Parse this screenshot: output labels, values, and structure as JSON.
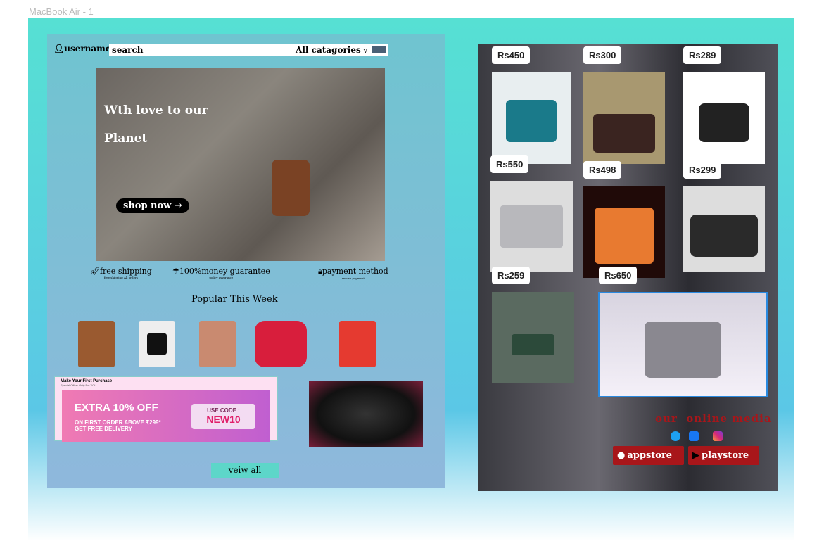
{
  "frame_label": "MacBook Air - 1",
  "header": {
    "username": "username",
    "search_placeholder": "search",
    "category": "All catagories",
    "chevron": "v"
  },
  "hero": {
    "line1": "Wth love to our",
    "line2": "Planet",
    "cta": "shop now",
    "arrow": "→"
  },
  "features": [
    {
      "title": "free shipping",
      "sub": "free shipping All orders",
      "icon": "rocket-icon"
    },
    {
      "title": "100%money guarantee",
      "sub": "policy assurance",
      "icon": "umbrella-icon"
    },
    {
      "title": "payment method",
      "sub": "secure payment",
      "icon": "lock-icon"
    }
  ],
  "popular": {
    "title": "Popular This Week",
    "view_all": "veiw all"
  },
  "promo": {
    "heading": "Make Your First Purchase",
    "sub": "Special Offers Only For YOU",
    "big": "EXTRA 10% OFF",
    "line1": "ON FIRST ORDER ABOVE ₹299*",
    "line2": "GET FREE DELIVERY",
    "code_label": "USE CODE :",
    "code": "NEW10"
  },
  "products": [
    {
      "price": "Rs450",
      "color": "#1a7a8a"
    },
    {
      "price": "Rs300",
      "color": "#3a2420"
    },
    {
      "price": "Rs289",
      "color": "#222"
    },
    {
      "price": "Rs550",
      "color": "#b8b8bc"
    },
    {
      "price": "Rs498",
      "color": "#e87a30"
    },
    {
      "price": "Rs299",
      "color": "#2a2a2a"
    },
    {
      "price": "Rs259",
      "color": "#2c4a3a"
    },
    {
      "price": "Rs650",
      "color": "#8a8890"
    }
  ],
  "media": {
    "title": "our  online media",
    "appstore": "appstore",
    "playstore": "playstore"
  },
  "colors": {
    "accent": "#a8161a",
    "teal": "#56e0d3"
  }
}
